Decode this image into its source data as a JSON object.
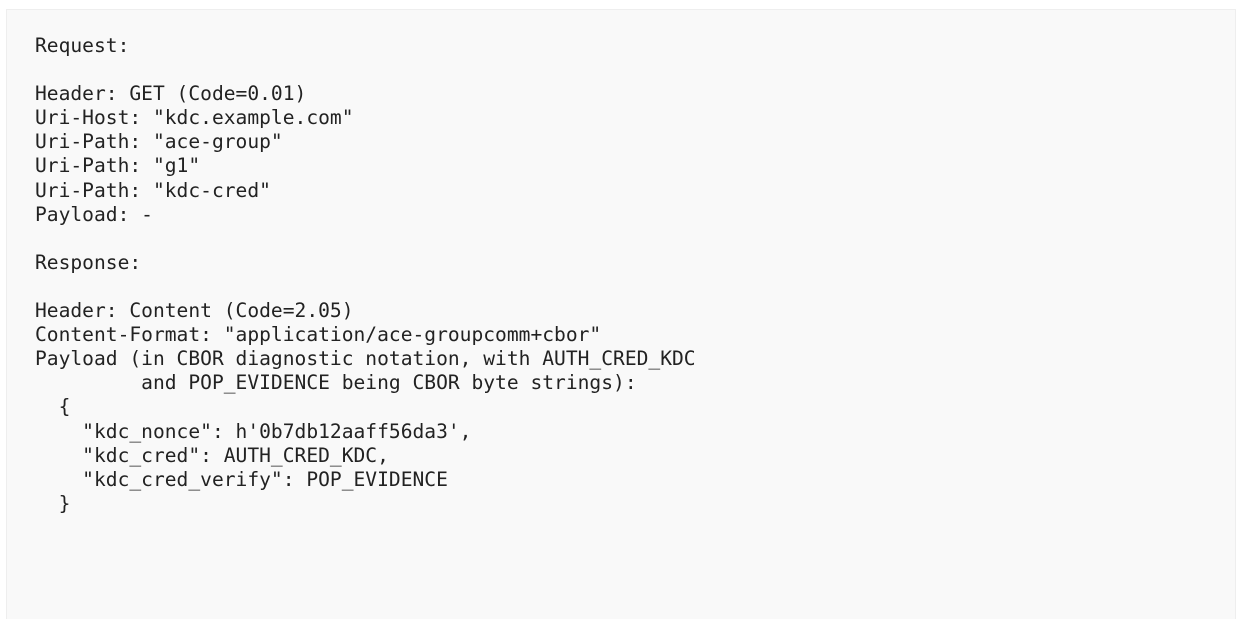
{
  "code_lines": [
    "Request:",
    "",
    "Header: GET (Code=0.01)",
    "Uri-Host: \"kdc.example.com\"",
    "Uri-Path: \"ace-group\"",
    "Uri-Path: \"g1\"",
    "Uri-Path: \"kdc-cred\"",
    "Payload: -",
    "",
    "Response:",
    "",
    "Header: Content (Code=2.05)",
    "Content-Format: \"application/ace-groupcomm+cbor\"",
    "Payload (in CBOR diagnostic notation, with AUTH_CRED_KDC",
    "         and POP_EVIDENCE being CBOR byte strings):",
    "  {",
    "    \"kdc_nonce\": h'0b7db12aaff56da3',",
    "    \"kdc_cred\": AUTH_CRED_KDC,",
    "    \"kdc_cred_verify\": POP_EVIDENCE",
    "  }"
  ]
}
